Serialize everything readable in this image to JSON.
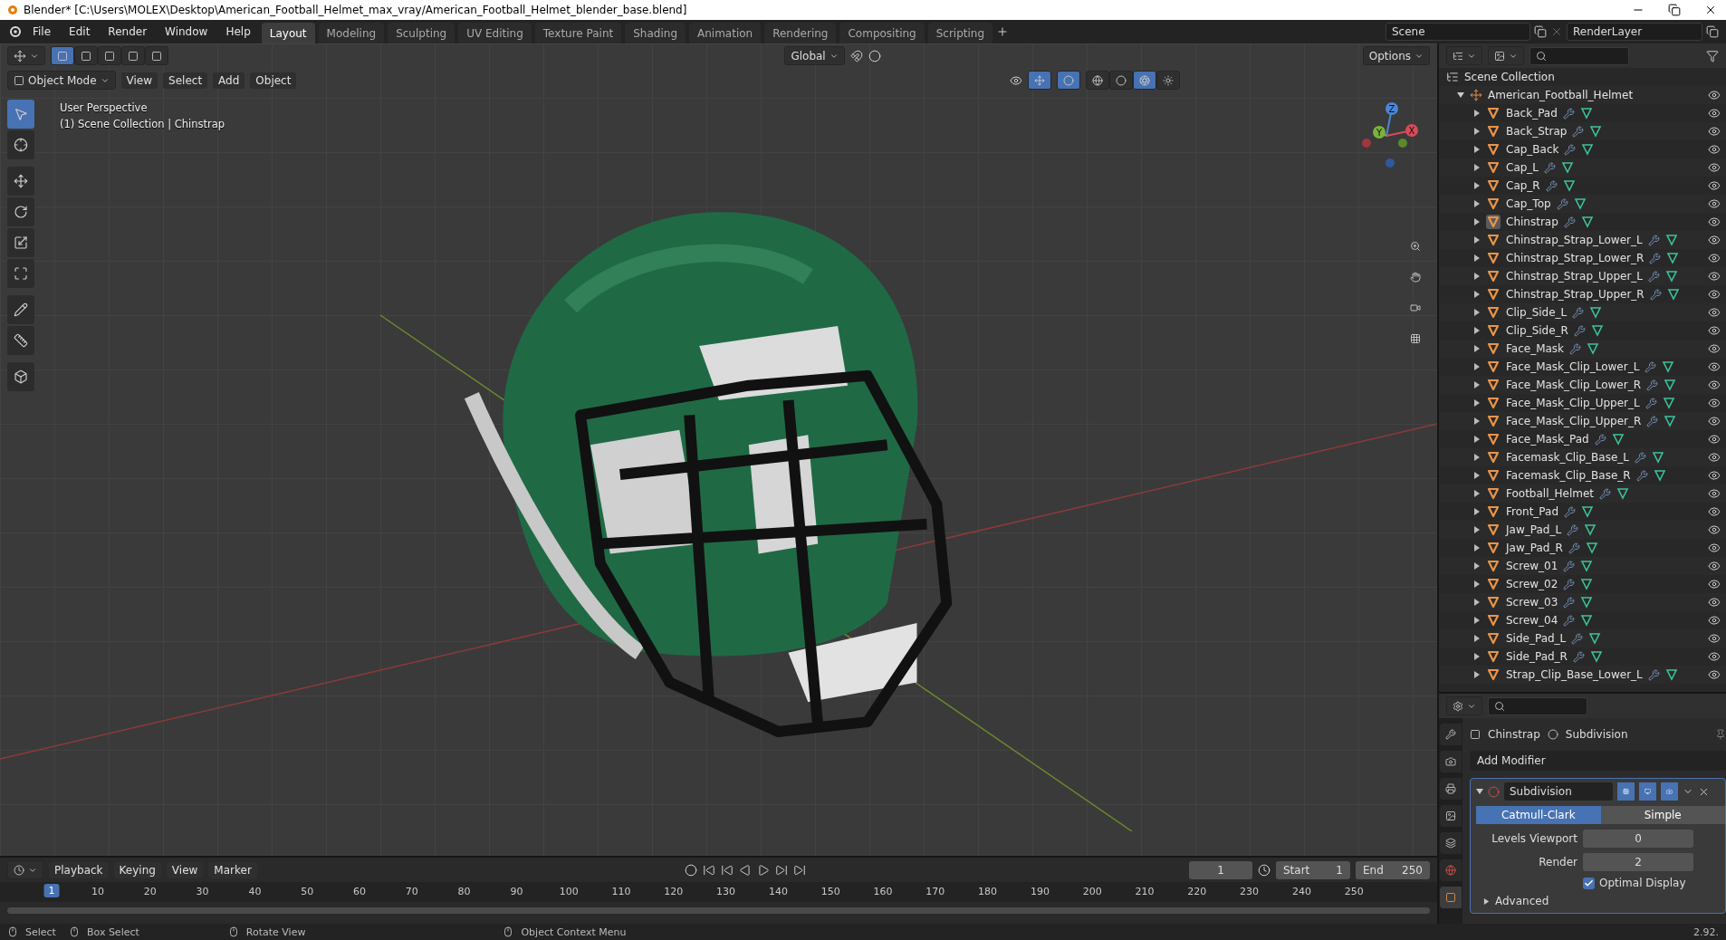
{
  "window": {
    "title": "Blender* [C:\\Users\\MOLEX\\Desktop\\American_Football_Helmet_max_vray/American_Football_Helmet_blender_base.blend]"
  },
  "menu": [
    "File",
    "Edit",
    "Render",
    "Window",
    "Help"
  ],
  "workspaces": [
    {
      "label": "Layout",
      "selected": true
    },
    {
      "label": "Modeling",
      "selected": false
    },
    {
      "label": "Sculpting",
      "selected": false
    },
    {
      "label": "UV Editing",
      "selected": false
    },
    {
      "label": "Texture Paint",
      "selected": false
    },
    {
      "label": "Shading",
      "selected": false
    },
    {
      "label": "Animation",
      "selected": false
    },
    {
      "label": "Rendering",
      "selected": false
    },
    {
      "label": "Compositing",
      "selected": false
    },
    {
      "label": "Scripting",
      "selected": false
    }
  ],
  "scene_field": "Scene",
  "layer_field": "RenderLayer",
  "viewport": {
    "select_modes": [
      {
        "selected": true
      },
      {
        "selected": false
      },
      {
        "selected": false
      },
      {
        "selected": false
      },
      {
        "selected": false
      }
    ],
    "orientation": "Global",
    "options": "Options",
    "mode": "Object Mode",
    "header_menu": [
      "View",
      "Select",
      "Add",
      "Object"
    ],
    "gizmo_on": true,
    "overlays_on": true,
    "shading": [
      {
        "kind": "wireframe",
        "selected": false
      },
      {
        "kind": "solid",
        "selected": false
      },
      {
        "kind": "material",
        "selected": true
      },
      {
        "kind": "rendered",
        "selected": false
      }
    ],
    "tools": [
      {
        "kind": "select",
        "selected": true
      },
      {
        "kind": "cursor",
        "selected": false
      },
      {
        "kind": "move",
        "selected": false
      },
      {
        "kind": "rotate",
        "selected": false
      },
      {
        "kind": "scale",
        "selected": false
      },
      {
        "kind": "transform",
        "selected": false
      },
      {
        "kind": "annotate",
        "selected": false
      },
      {
        "kind": "measure",
        "selected": false
      },
      {
        "kind": "add-cube",
        "selected": false
      }
    ],
    "info": [
      "User Perspective",
      "(1) Scene Collection | Chinstrap"
    ],
    "axes": [
      "Z",
      "Y",
      "X"
    ]
  },
  "outliner": {
    "title": "Scene Collection",
    "collections": [
      {
        "name": "American_Football_Helmet",
        "expanded": true,
        "children": [
          {
            "name": "Back_Pad",
            "active": false
          },
          {
            "name": "Back_Strap",
            "active": false
          },
          {
            "name": "Cap_Back",
            "active": false
          },
          {
            "name": "Cap_L",
            "active": false
          },
          {
            "name": "Cap_R",
            "active": false
          },
          {
            "name": "Cap_Top",
            "active": false
          },
          {
            "name": "Chinstrap",
            "active": true
          },
          {
            "name": "Chinstrap_Strap_Lower_L",
            "active": false
          },
          {
            "name": "Chinstrap_Strap_Lower_R",
            "active": false
          },
          {
            "name": "Chinstrap_Strap_Upper_L",
            "active": false
          },
          {
            "name": "Chinstrap_Strap_Upper_R",
            "active": false
          },
          {
            "name": "Clip_Side_L",
            "active": false
          },
          {
            "name": "Clip_Side_R",
            "active": false
          },
          {
            "name": "Face_Mask",
            "active": false
          },
          {
            "name": "Face_Mask_Clip_Lower_L",
            "active": false
          },
          {
            "name": "Face_Mask_Clip_Lower_R",
            "active": false
          },
          {
            "name": "Face_Mask_Clip_Upper_L",
            "active": false
          },
          {
            "name": "Face_Mask_Clip_Upper_R",
            "active": false
          },
          {
            "name": "Face_Mask_Pad",
            "active": false
          },
          {
            "name": "Facemask_Clip_Base_L",
            "active": false
          },
          {
            "name": "Facemask_Clip_Base_R",
            "active": false
          },
          {
            "name": "Football_Helmet",
            "active": false
          },
          {
            "name": "Front_Pad",
            "active": false
          },
          {
            "name": "Jaw_Pad_L",
            "active": false
          },
          {
            "name": "Jaw_Pad_R",
            "active": false
          },
          {
            "name": "Screw_01",
            "active": false
          },
          {
            "name": "Screw_02",
            "active": false
          },
          {
            "name": "Screw_03",
            "active": false
          },
          {
            "name": "Screw_04",
            "active": false
          },
          {
            "name": "Side_Pad_L",
            "active": false
          },
          {
            "name": "Side_Pad_R",
            "active": false
          },
          {
            "name": "Strap_Clip_Base_Lower_L",
            "active": false
          }
        ]
      }
    ]
  },
  "properties": {
    "tabs": [
      {
        "kind": "tool",
        "selected": false
      },
      {
        "kind": "render",
        "selected": false
      },
      {
        "kind": "output",
        "selected": false
      },
      {
        "kind": "view-layer",
        "selected": false
      },
      {
        "kind": "scene",
        "selected": false
      },
      {
        "kind": "world",
        "selected": false
      },
      {
        "kind": "object",
        "selected": true
      }
    ],
    "breadcrumb": [
      "Chinstrap",
      "Subdivision"
    ],
    "add_modifier": "Add Modifier",
    "modifier": {
      "name": "Subdivision",
      "expanded": true,
      "toggles": [
        {
          "kind": "editmode",
          "on": true
        },
        {
          "kind": "viewport",
          "on": true
        },
        {
          "kind": "render",
          "on": true
        }
      ],
      "types": [
        {
          "label": "Catmull-Clark",
          "selected": true
        },
        {
          "label": "Simple",
          "selected": false
        }
      ],
      "fields": [
        {
          "label": "Levels Viewport",
          "value": "0"
        },
        {
          "label": "Render",
          "value": "2"
        }
      ],
      "optimal_display": {
        "label": "Optimal Display",
        "checked": true
      },
      "advanced": {
        "label": "Advanced",
        "expanded": false
      }
    }
  },
  "timeline": {
    "menu": [
      "Playback",
      "Keying",
      "View",
      "Marker"
    ],
    "current_frame": "1",
    "start_label": "Start",
    "start": "1",
    "end_label": "End",
    "end": "250",
    "playhead": "1",
    "ticks": [
      "10",
      "20",
      "30",
      "40",
      "50",
      "60",
      "70",
      "80",
      "90",
      "100",
      "110",
      "120",
      "130",
      "140",
      "150",
      "160",
      "170",
      "180",
      "190",
      "200",
      "210",
      "220",
      "230",
      "240",
      "250"
    ]
  },
  "status_bar": {
    "hints": [
      "Select",
      "Box Select",
      "Rotate View",
      "Object Context Menu"
    ],
    "version": "2.92."
  }
}
